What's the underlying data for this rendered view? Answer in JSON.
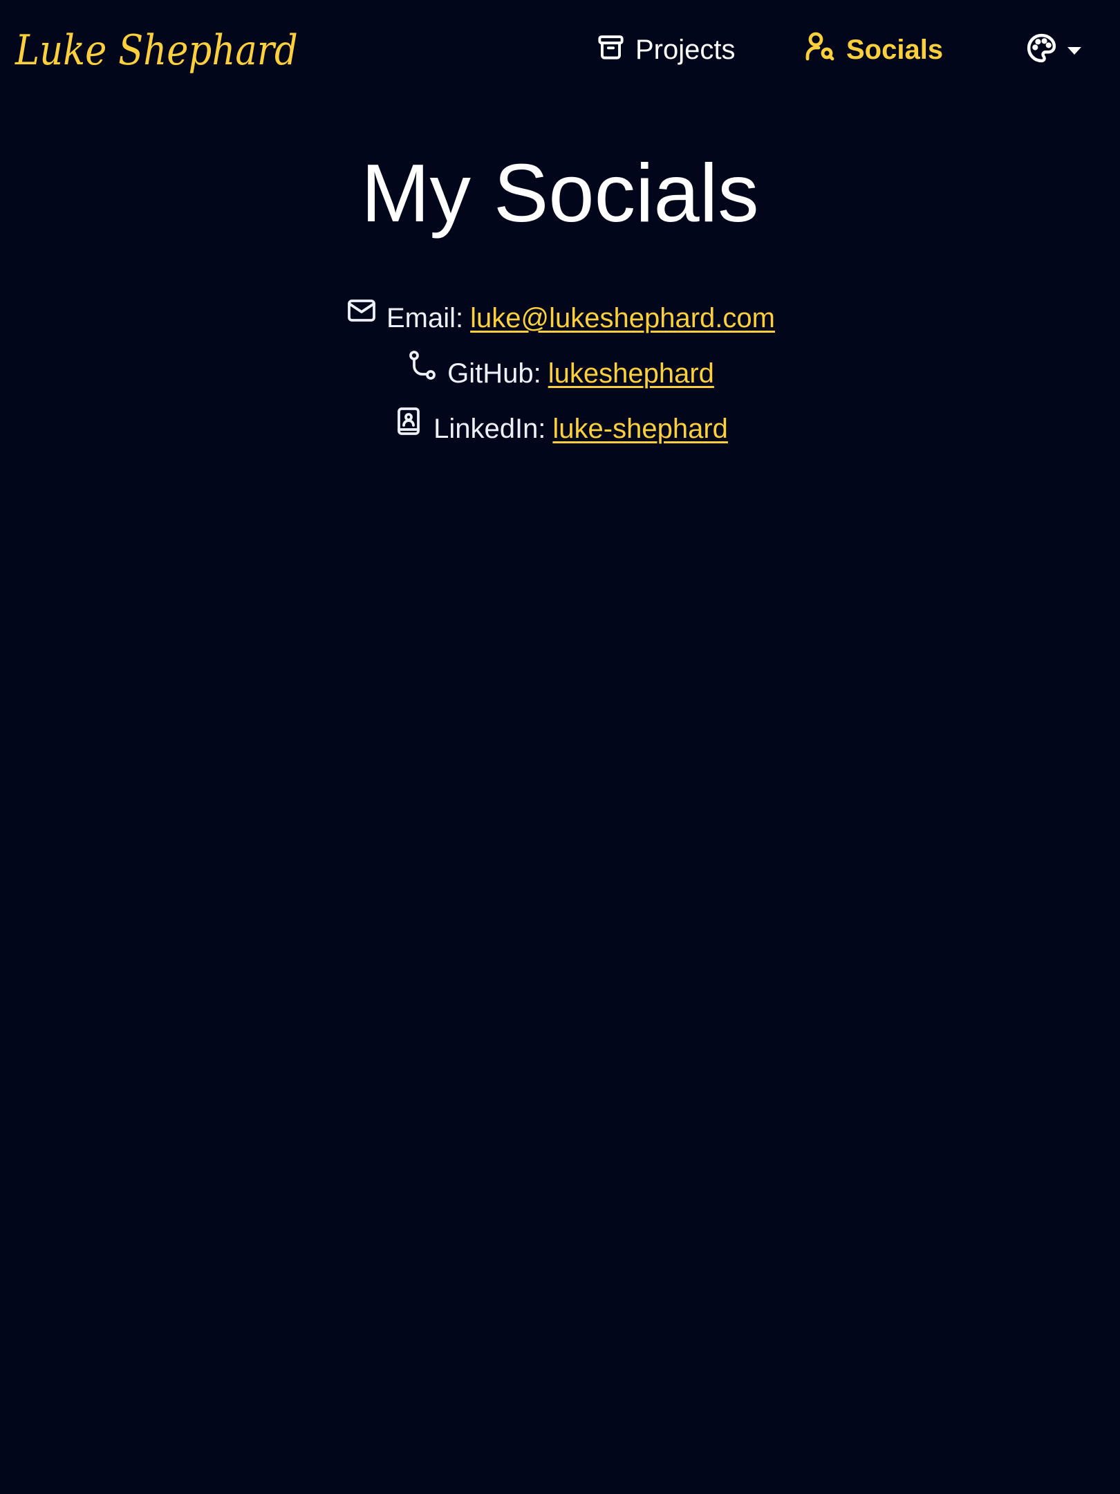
{
  "header": {
    "brand": "Luke Shephard",
    "nav": [
      {
        "label": "Projects",
        "icon": "archive-box-icon",
        "active": false
      },
      {
        "label": "Socials",
        "icon": "user-search-icon",
        "active": true
      }
    ],
    "theme_selector": {
      "icon": "palette-icon",
      "dropdown_icon": "chevron-down-icon"
    }
  },
  "main": {
    "title": "My Socials",
    "socials": [
      {
        "label": "Email:",
        "link": "luke@lukeshephard.com",
        "icon": "mail-icon"
      },
      {
        "label": "GitHub:",
        "link": "lukeshephard",
        "icon": "git-branch-icon"
      },
      {
        "label": "LinkedIn:",
        "link": "luke-shephard",
        "icon": "contact-book-icon"
      }
    ]
  },
  "colors": {
    "background": "#01061a",
    "accent": "#fccf3c",
    "text": "#eef0f7"
  }
}
